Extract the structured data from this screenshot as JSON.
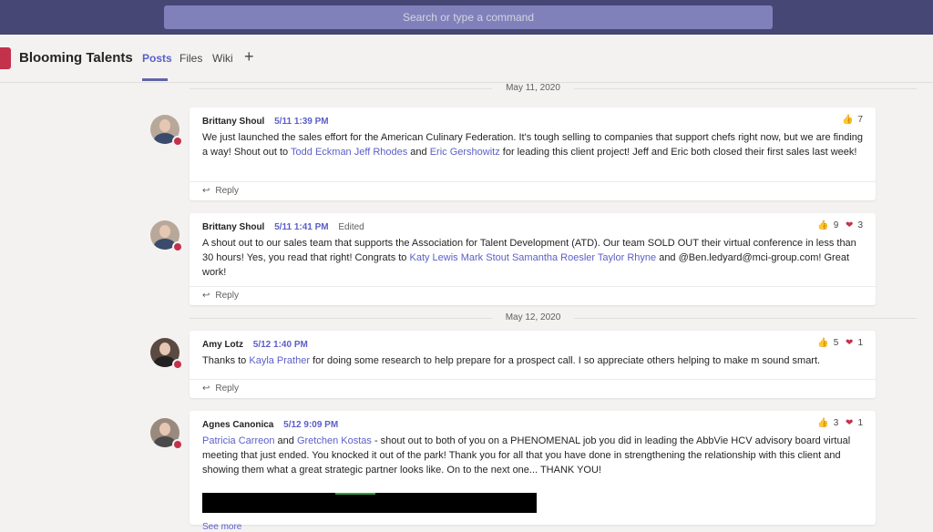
{
  "search": {
    "placeholder": "Search or type a command"
  },
  "team": {
    "name": "Blooming Talents"
  },
  "tabs": [
    {
      "label": "Posts",
      "active": true
    },
    {
      "label": "Files",
      "active": false
    },
    {
      "label": "Wiki",
      "active": false
    }
  ],
  "add_tab_icon": "plus-icon",
  "dates": [
    "May 11, 2020",
    "May 12, 2020"
  ],
  "posts": [
    {
      "author": "Brittany Shoul",
      "time": "5/11 1:39 PM",
      "edited": "",
      "text_parts": [
        "We just launched the sales effort for the American Culinary Federation. It's tough selling to companies that support chefs right now, but we are finding a way! Shout out to ",
        "Todd Eckman Jeff Rhodes",
        " and ",
        "Eric Gershowitz",
        " for leading this client project! Jeff and Eric both closed their first sales last week!"
      ],
      "likes": "7",
      "hearts": "",
      "reply": "Reply"
    },
    {
      "author": "Brittany Shoul",
      "time": "5/11 1:41 PM",
      "edited": "Edited",
      "text_parts": [
        "A shout out to our sales team that supports the Association for Talent Development (ATD). Our team SOLD OUT their virtual conference in less than 30 hours! Yes, you read that right! Congrats to ",
        "Katy Lewis Mark Stout Samantha Roesler Taylor Rhyne",
        " and @Ben.ledyard@mci-group.com! Great work!"
      ],
      "likes": "9",
      "hearts": "3",
      "reply": "Reply"
    },
    {
      "author": "Amy Lotz",
      "time": "5/12 1:40 PM",
      "edited": "",
      "text_parts": [
        "Thanks to ",
        "Kayla Prather",
        " for doing some research to help prepare for a prospect call.  I so appreciate others helping to make m sound smart."
      ],
      "likes": "5",
      "hearts": "1",
      "reply": "Reply"
    },
    {
      "author": "Agnes Canonica",
      "time": "5/12 9:09 PM",
      "edited": "",
      "text_parts": [
        "Patricia Carreon",
        " and ",
        "Gretchen Kostas",
        " - shout out to both of you on a PHENOMENAL job you did in leading the AbbVie HCV advisory board virtual meeting that just ended. You knocked it out of the park! Thank you for all that you have done in strengthening the relationship with this client and showing them what a great strategic partner looks like. On to the next one... THANK YOU!"
      ],
      "likes": "3",
      "hearts": "1",
      "see_more": "See more"
    }
  ],
  "colors": {
    "topbar": "#464775",
    "accent": "#5b5fc7",
    "presence_busy": "#c4314b"
  }
}
